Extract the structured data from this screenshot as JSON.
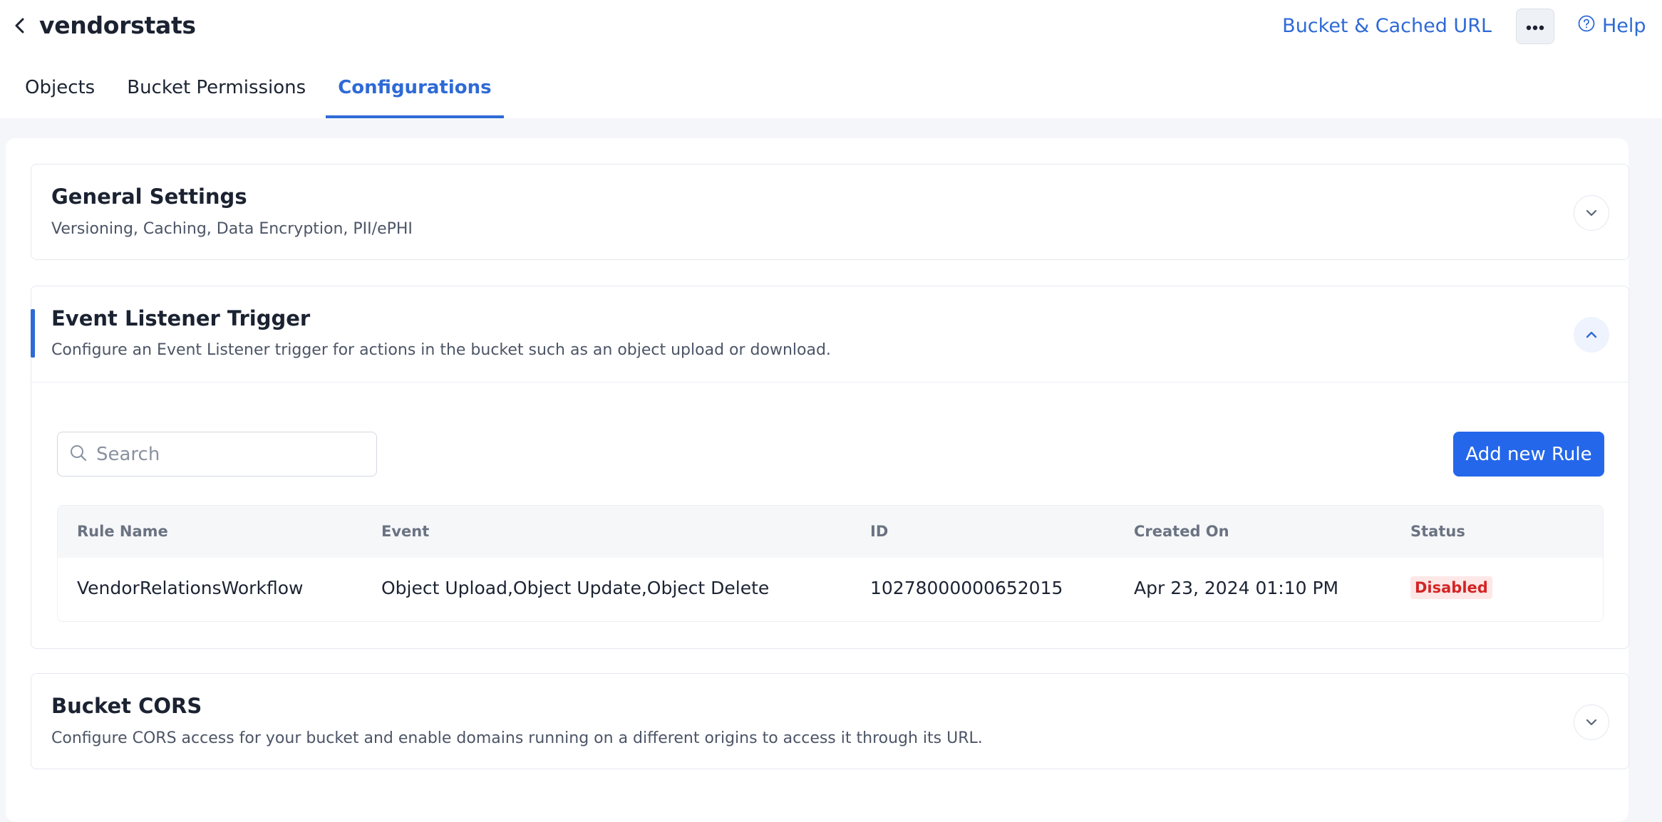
{
  "header": {
    "title": "vendorstats",
    "bucket_url_label": "Bucket & Cached URL",
    "help_label": "Help"
  },
  "tabs": [
    {
      "label": "Objects",
      "active": false
    },
    {
      "label": "Bucket Permissions",
      "active": false
    },
    {
      "label": "Configurations",
      "active": true
    }
  ],
  "sections": {
    "general": {
      "title": "General Settings",
      "description": "Versioning, Caching, Data Encryption, PII/ePHI",
      "expanded": false
    },
    "event_listener": {
      "title": "Event Listener Trigger",
      "description": "Configure an Event Listener trigger for actions in the bucket such as an object upload or download.",
      "expanded": true,
      "search_placeholder": "Search",
      "add_button_label": "Add new Rule",
      "table": {
        "columns": [
          "Rule Name",
          "Event",
          "ID",
          "Created On",
          "Status"
        ],
        "rows": [
          {
            "rule_name": "VendorRelationsWorkflow",
            "event": "Object Upload,Object Update,Object Delete",
            "id": "10278000000652015",
            "created_on": "Apr 23, 2024 01:10 PM",
            "status": "Disabled"
          }
        ]
      }
    },
    "cors": {
      "title": "Bucket CORS",
      "description": "Configure CORS access for your bucket and enable domains running on a different origins to access it through its URL.",
      "expanded": false
    }
  },
  "colors": {
    "accent": "#2e6ad6",
    "primary_button": "#2467ea",
    "status_disabled_text": "#d42424",
    "status_disabled_bg": "#fde7e7"
  },
  "icons": {
    "back": "chevron-left-icon",
    "more": "more-horizontal-icon",
    "help": "help-circle-icon",
    "search": "search-icon",
    "expand": "chevron-down-icon",
    "collapse": "chevron-up-icon"
  }
}
